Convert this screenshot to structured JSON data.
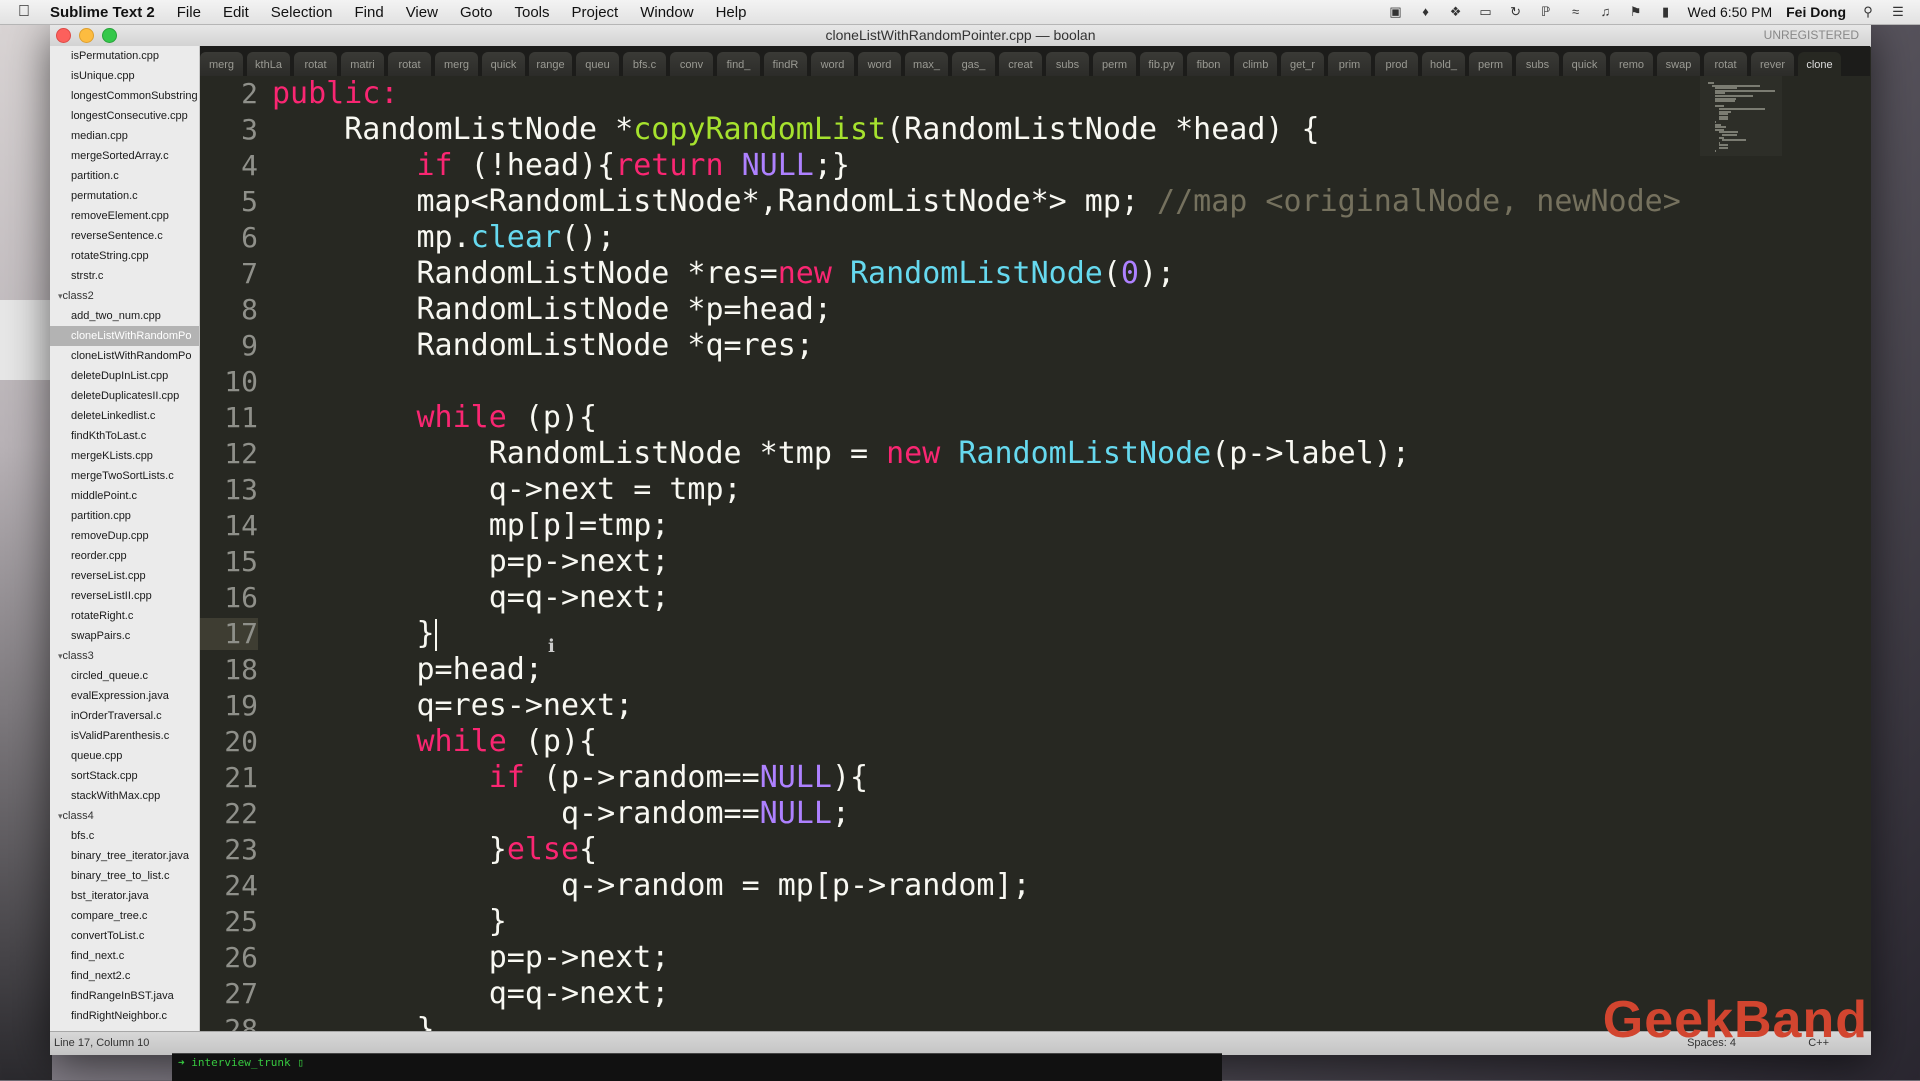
{
  "menubar": {
    "app_name": "Sublime Text 2",
    "menus": [
      "File",
      "Edit",
      "Selection",
      "Find",
      "View",
      "Goto",
      "Tools",
      "Project",
      "Window",
      "Help"
    ],
    "clock": "Wed 6:50 PM",
    "user": "Fei Dong"
  },
  "window": {
    "title": "cloneListWithRandomPointer.cpp — boolan",
    "unregistered": "UNREGISTERED"
  },
  "sidebar": {
    "items": [
      {
        "label": "isPermutation.cpp",
        "kind": "file"
      },
      {
        "label": "isUnique.cpp",
        "kind": "file"
      },
      {
        "label": "longestCommonSubstring",
        "kind": "file"
      },
      {
        "label": "longestConsecutive.cpp",
        "kind": "file"
      },
      {
        "label": "median.cpp",
        "kind": "file"
      },
      {
        "label": "mergeSortedArray.c",
        "kind": "file"
      },
      {
        "label": "partition.c",
        "kind": "file"
      },
      {
        "label": "permutation.c",
        "kind": "file"
      },
      {
        "label": "removeElement.cpp",
        "kind": "file"
      },
      {
        "label": "reverseSentence.c",
        "kind": "file"
      },
      {
        "label": "rotateString.cpp",
        "kind": "file"
      },
      {
        "label": "strstr.c",
        "kind": "file"
      },
      {
        "label": "class2",
        "kind": "folder"
      },
      {
        "label": "add_two_num.cpp",
        "kind": "file"
      },
      {
        "label": "cloneListWithRandomPo",
        "kind": "file",
        "selected": true
      },
      {
        "label": "cloneListWithRandomPo",
        "kind": "file"
      },
      {
        "label": "deleteDupInList.cpp",
        "kind": "file"
      },
      {
        "label": "deleteDuplicatesII.cpp",
        "kind": "file"
      },
      {
        "label": "deleteLinkedlist.c",
        "kind": "file"
      },
      {
        "label": "findKthToLast.c",
        "kind": "file"
      },
      {
        "label": "mergeKLists.cpp",
        "kind": "file"
      },
      {
        "label": "mergeTwoSortLists.c",
        "kind": "file"
      },
      {
        "label": "middlePoint.c",
        "kind": "file"
      },
      {
        "label": "partition.cpp",
        "kind": "file"
      },
      {
        "label": "removeDup.cpp",
        "kind": "file"
      },
      {
        "label": "reorder.cpp",
        "kind": "file"
      },
      {
        "label": "reverseList.cpp",
        "kind": "file"
      },
      {
        "label": "reverseListII.cpp",
        "kind": "file"
      },
      {
        "label": "rotateRight.c",
        "kind": "file"
      },
      {
        "label": "swapPairs.c",
        "kind": "file"
      },
      {
        "label": "class3",
        "kind": "folder"
      },
      {
        "label": "circled_queue.c",
        "kind": "file"
      },
      {
        "label": "evalExpression.java",
        "kind": "file"
      },
      {
        "label": "inOrderTraversal.c",
        "kind": "file"
      },
      {
        "label": "isValidParenthesis.c",
        "kind": "file"
      },
      {
        "label": "queue.cpp",
        "kind": "file"
      },
      {
        "label": "sortStack.cpp",
        "kind": "file"
      },
      {
        "label": "stackWithMax.cpp",
        "kind": "file"
      },
      {
        "label": "class4",
        "kind": "folder"
      },
      {
        "label": "bfs.c",
        "kind": "file"
      },
      {
        "label": "binary_tree_iterator.java",
        "kind": "file"
      },
      {
        "label": "binary_tree_to_list.c",
        "kind": "file"
      },
      {
        "label": "bst_iterator.java",
        "kind": "file"
      },
      {
        "label": "compare_tree.c",
        "kind": "file"
      },
      {
        "label": "convertToList.c",
        "kind": "file"
      },
      {
        "label": "find_next.c",
        "kind": "file"
      },
      {
        "label": "find_next2.c",
        "kind": "file"
      },
      {
        "label": "findRangeInBST.java",
        "kind": "file"
      },
      {
        "label": "findRightNeighbor.c",
        "kind": "file"
      }
    ]
  },
  "tabs": [
    "merg",
    "kthLa",
    "rotat",
    "matri",
    "rotat",
    "merg",
    "quick",
    "range",
    "queu",
    "bfs.c",
    "conv",
    "find_",
    "findR",
    "word",
    "word",
    "max_",
    "gas_",
    "creat",
    "subs",
    "perm",
    "fib.py",
    "fibon",
    "climb",
    "get_r",
    "prim",
    "prod",
    "hold_",
    "perm",
    "subs",
    "quick",
    "remo",
    "swap",
    "rotat",
    "rever",
    "clone"
  ],
  "editor": {
    "first_line_number": 2,
    "current_line": 17,
    "lines": [
      [
        {
          "t": "public:",
          "c": "kw"
        }
      ],
      [
        {
          "t": "    RandomListNode *"
        },
        {
          "t": "copyRandomList",
          "c": "fn"
        },
        {
          "t": "(RandomListNode *head) {"
        }
      ],
      [
        {
          "t": "        "
        },
        {
          "t": "if",
          "c": "kw"
        },
        {
          "t": " (!head){"
        },
        {
          "t": "return",
          "c": "kw"
        },
        {
          "t": " "
        },
        {
          "t": "NULL",
          "c": "nu"
        },
        {
          "t": ";}"
        }
      ],
      [
        {
          "t": "        map<RandomListNode*,RandomListNode*> mp; "
        },
        {
          "t": "//map <originalNode, newNode>",
          "c": "cm"
        }
      ],
      [
        {
          "t": "        mp."
        },
        {
          "t": "clear",
          "c": "ty"
        },
        {
          "t": "();"
        }
      ],
      [
        {
          "t": "        RandomListNode *res="
        },
        {
          "t": "new",
          "c": "kw"
        },
        {
          "t": " "
        },
        {
          "t": "RandomListNode",
          "c": "ty"
        },
        {
          "t": "("
        },
        {
          "t": "0",
          "c": "nu"
        },
        {
          "t": ");"
        }
      ],
      [
        {
          "t": "        RandomListNode *p=head;"
        }
      ],
      [
        {
          "t": "        RandomListNode *q=res;"
        }
      ],
      [
        {
          "t": ""
        }
      ],
      [
        {
          "t": "        "
        },
        {
          "t": "while",
          "c": "kw"
        },
        {
          "t": " (p){"
        }
      ],
      [
        {
          "t": "            RandomListNode *tmp = "
        },
        {
          "t": "new",
          "c": "kw"
        },
        {
          "t": " "
        },
        {
          "t": "RandomListNode",
          "c": "ty"
        },
        {
          "t": "(p->label);"
        }
      ],
      [
        {
          "t": "            q->next = tmp;"
        }
      ],
      [
        {
          "t": "            mp[p]=tmp;"
        }
      ],
      [
        {
          "t": "            p=p->next;"
        }
      ],
      [
        {
          "t": "            q=q->next;"
        }
      ],
      [
        {
          "t": "        }"
        },
        {
          "caret": true
        }
      ],
      [
        {
          "t": "        p=head;"
        }
      ],
      [
        {
          "t": "        q=res->next;"
        }
      ],
      [
        {
          "t": "        "
        },
        {
          "t": "while",
          "c": "kw"
        },
        {
          "t": " (p){"
        }
      ],
      [
        {
          "t": "            "
        },
        {
          "t": "if",
          "c": "kw"
        },
        {
          "t": " (p->random=="
        },
        {
          "t": "NULL",
          "c": "nu"
        },
        {
          "t": "){"
        }
      ],
      [
        {
          "t": "                q->random=="
        },
        {
          "t": "NULL",
          "c": "nu"
        },
        {
          "t": ";"
        }
      ],
      [
        {
          "t": "            }"
        },
        {
          "t": "else",
          "c": "kw"
        },
        {
          "t": "{"
        }
      ],
      [
        {
          "t": "                q->random = mp[p->random];"
        }
      ],
      [
        {
          "t": "            }"
        }
      ],
      [
        {
          "t": "            p=p->next;"
        }
      ],
      [
        {
          "t": "            q=q->next;"
        }
      ],
      [
        {
          "t": "        }"
        }
      ]
    ]
  },
  "statusbar": {
    "position": "Line 17, Column 10",
    "indent": "Spaces: 4",
    "syntax": "C++"
  },
  "terminal": {
    "prompt": "➜  interview_trunk  ▯"
  },
  "watermark": "GeekBand",
  "colors": {
    "editor_bg": "#272822",
    "keyword": "#f92672",
    "function": "#a6e22e",
    "type": "#66d9ef",
    "number": "#ae81ff",
    "comment": "#75715e",
    "watermark": "#d2452f"
  },
  "icons": [
    "apple-icon",
    "camera-icon",
    "bell-icon",
    "dropbox-icon",
    "airplay-icon",
    "time-machine-icon",
    "bluetooth-icon",
    "wifi-icon",
    "volume-icon",
    "flag-icon",
    "battery-icon",
    "spotlight-icon",
    "notification-list-icon"
  ]
}
